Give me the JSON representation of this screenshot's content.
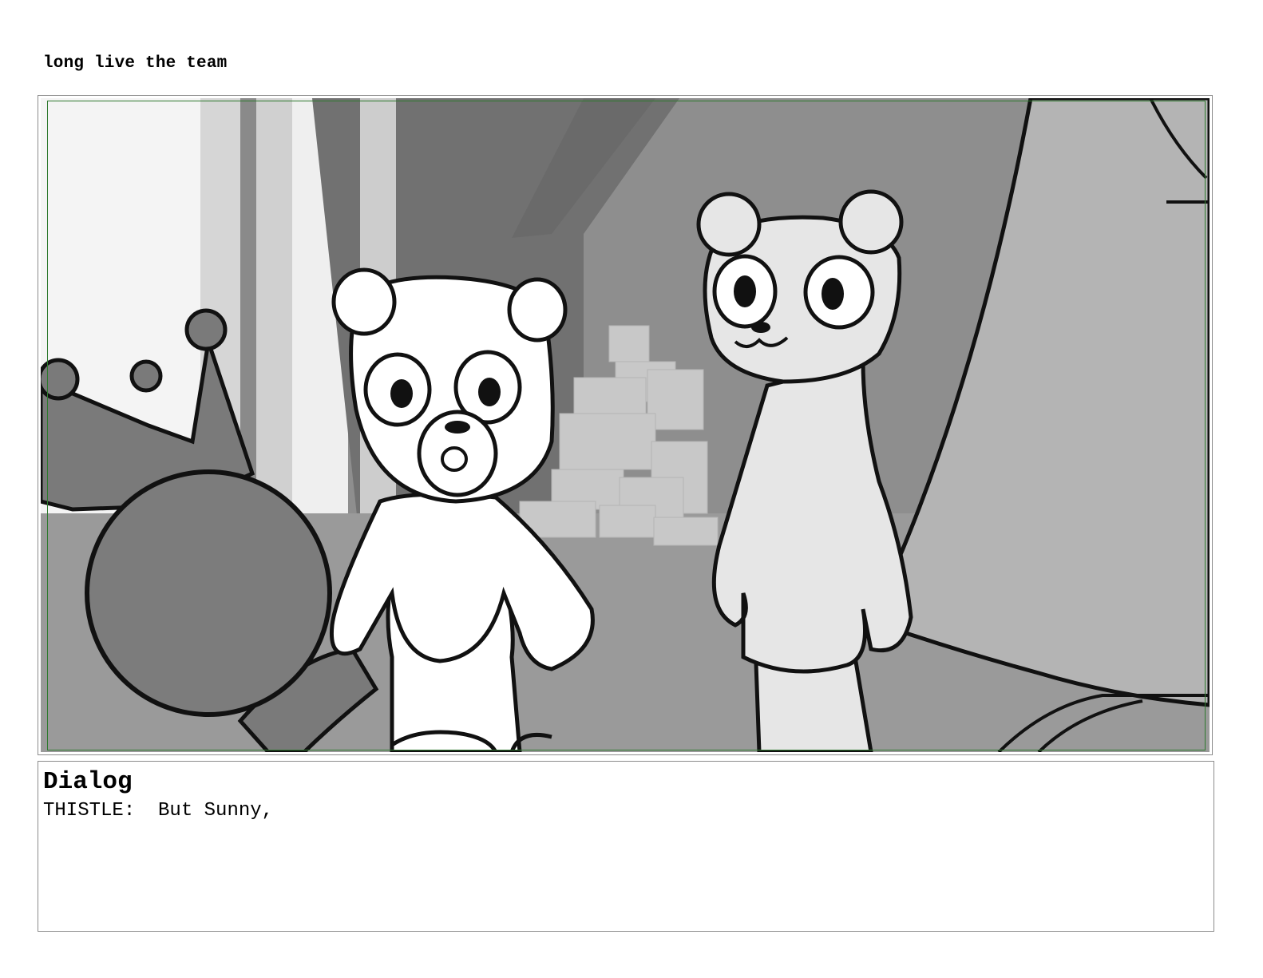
{
  "document": {
    "title": "long live the team"
  },
  "panel": {
    "image_description_icon": "storyboard-sketch-image",
    "safe_area_color": "#2f7a2f"
  },
  "dialog": {
    "heading": "Dialog",
    "line": "THISTLE:  But Sunny,"
  }
}
